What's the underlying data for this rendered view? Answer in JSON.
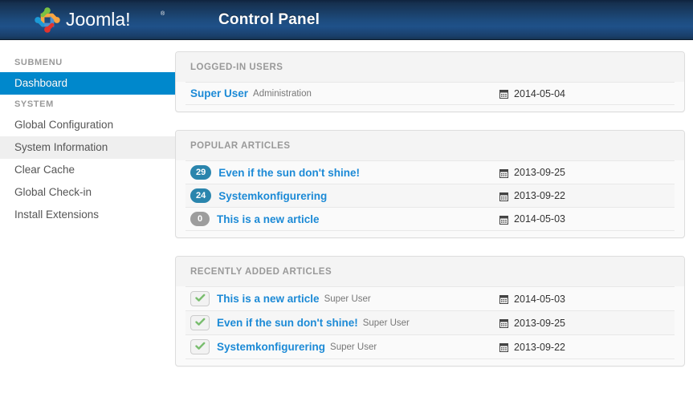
{
  "header": {
    "logo_alt": "Joomla!",
    "logo_text": "Joomla!",
    "title": "Control Panel",
    "gradient_top": "#0f243e",
    "gradient_mid": "#1f5189",
    "gradient_bottom": "#14304f"
  },
  "sidebar": {
    "groups": [
      {
        "heading": "SUBMENU",
        "items": [
          {
            "label": "Dashboard",
            "state": "active"
          }
        ]
      },
      {
        "heading": "SYSTEM",
        "items": [
          {
            "label": "Global Configuration",
            "state": "normal"
          },
          {
            "label": "System Information",
            "state": "hover"
          },
          {
            "label": "Clear Cache",
            "state": "normal"
          },
          {
            "label": "Global Check-in",
            "state": "normal"
          },
          {
            "label": "Install Extensions",
            "state": "normal"
          }
        ]
      }
    ],
    "active_color": "#0088cc",
    "hover_color": "#efefef"
  },
  "panels": {
    "logged_in_users": {
      "heading": "LOGGED-IN USERS",
      "rows": [
        {
          "user": "Super User",
          "group": "Administration",
          "date": "2014-05-04",
          "date_icon": "calendar-icon"
        }
      ]
    },
    "popular_articles": {
      "heading": "POPULAR ARTICLES",
      "rows": [
        {
          "hits": "29",
          "title": "Even if the sun don't shine!",
          "date": "2013-09-25",
          "date_icon": "calendar-icon",
          "badge_color": "#2a85ad"
        },
        {
          "hits": "24",
          "title": "Systemkonfigurering",
          "date": "2013-09-22",
          "date_icon": "calendar-icon",
          "badge_color": "#2a85ad"
        },
        {
          "hits": "0",
          "title": "This is a new article",
          "date": "2014-05-03",
          "date_icon": "calendar-icon",
          "badge_color": "#9d9d9d"
        }
      ]
    },
    "recently_added_articles": {
      "heading": "RECENTLY ADDED ARTICLES",
      "rows": [
        {
          "status_icon": "check-icon",
          "title": "This is a new article",
          "author": "Super User",
          "date": "2014-05-03",
          "date_icon": "calendar-icon"
        },
        {
          "status_icon": "check-icon",
          "title": "Even if the sun don't shine!",
          "author": "Super User",
          "date": "2013-09-25",
          "date_icon": "calendar-icon"
        },
        {
          "status_icon": "check-icon",
          "title": "Systemkonfigurering",
          "author": "Super User",
          "date": "2013-09-22",
          "date_icon": "calendar-icon"
        }
      ]
    }
  },
  "colors": {
    "link": "#1c8ad6",
    "accent": "#0088cc",
    "check_green": "#79bd6e",
    "panel_bg": "#fafafa",
    "panel_border": "#dddddd"
  }
}
